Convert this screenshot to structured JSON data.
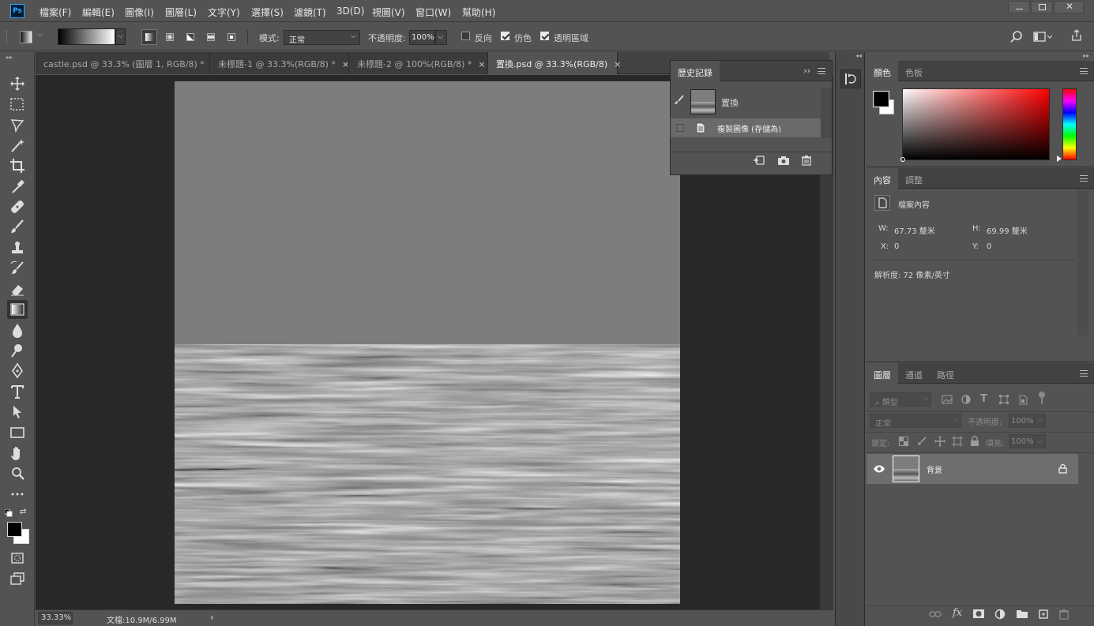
{
  "app": {
    "logo": "Ps"
  },
  "menu": [
    "檔案(F)",
    "編輯(E)",
    "圖像(I)",
    "圖層(L)",
    "文字(Y)",
    "選擇(S)",
    "濾鏡(T)",
    "3D(D)",
    "視圖(V)",
    "窗口(W)",
    "幫助(H)"
  ],
  "options": {
    "mode_label": "模式:",
    "mode_value": "正常",
    "opacity_label": "不透明度:",
    "opacity_value": "100%",
    "reverse_label": "反向",
    "reverse_checked": false,
    "dither_label": "仿色",
    "dither_checked": true,
    "transparency_label": "透明區域",
    "transparency_checked": true
  },
  "tabs": [
    {
      "label": "castle.psd @ 33.3% (圖層 1, RGB/8) *",
      "active": false
    },
    {
      "label": "未標題-1 @ 33.3%(RGB/8) *",
      "active": false
    },
    {
      "label": "未標題-2 @ 100%(RGB/8) *",
      "active": false
    },
    {
      "label": "置換.psd @ 33.3%(RGB/8)",
      "active": true
    }
  ],
  "tab_close": "×",
  "status": {
    "zoom": "33.33%",
    "doc_info": "文檔:10.9M/6.99M",
    "arrow": "›"
  },
  "history_panel": {
    "title": "歷史記錄",
    "collapse": "››",
    "snapshot_label": "置換",
    "step_label": "複製圖像 (存儲為)"
  },
  "color_panel": {
    "tabs": [
      "顏色",
      "色板"
    ],
    "foreground": "#000000",
    "background": "#ffffff",
    "hue": "#ff0000"
  },
  "properties_panel": {
    "tabs": [
      "內容",
      "調整"
    ],
    "type_label": "檔案內容",
    "w_label": "W:",
    "w_value": "67.73 釐米",
    "h_label": "H:",
    "h_value": "69.99 釐米",
    "x_label": "X:",
    "x_value": "0",
    "y_label": "Y:",
    "y_value": "0",
    "resolution": "解析度: 72 像素/英寸"
  },
  "layers_panel": {
    "tabs": [
      "圖層",
      "通道",
      "路徑"
    ],
    "filter_label": "類型",
    "blend_mode": "正常",
    "opacity_label": "不透明度:",
    "opacity_value": "100%",
    "lock_label": "鎖定:",
    "fill_label": "填充:",
    "fill_value": "100%",
    "layer_name": "背景"
  }
}
